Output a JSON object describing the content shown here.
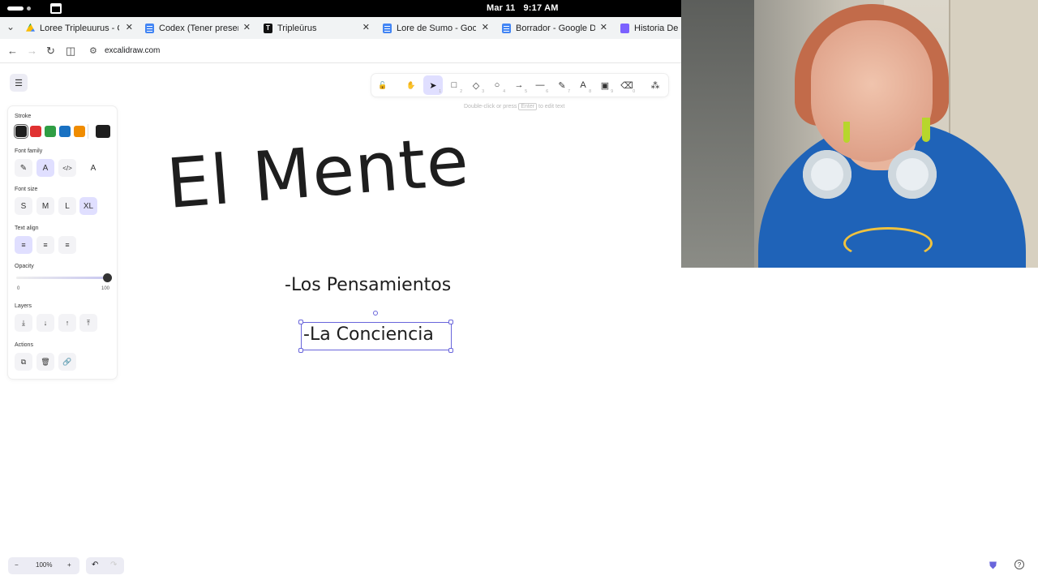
{
  "system": {
    "date": "Mar 11",
    "time": "9:17 AM"
  },
  "tabs": [
    {
      "label": "Loree Tripleuurus - Go",
      "icon": "drive-icon"
    },
    {
      "label": "Codex (Tener presente",
      "icon": "docs-icon"
    },
    {
      "label": "Tripleūrus",
      "icon": "t-icon",
      "glyph": "T"
    },
    {
      "label": "Lore de Sumo - Googl",
      "icon": "docs-icon"
    },
    {
      "label": "Borrador - Google Do",
      "icon": "docs-icon"
    },
    {
      "label": "Historia De Lo",
      "icon": "discord-icon"
    }
  ],
  "address": {
    "url": "excalidraw.com"
  },
  "toolbar": {
    "hint_before": "Double-click or press",
    "hint_key": "Enter",
    "hint_after": "to edit text",
    "tools": [
      {
        "name": "lock",
        "glyph": "🔓",
        "key": ""
      },
      {
        "name": "hand",
        "glyph": "✋",
        "key": ""
      },
      {
        "name": "selection",
        "glyph": "➤",
        "key": "1",
        "active": true
      },
      {
        "name": "rectangle",
        "glyph": "□",
        "key": "2"
      },
      {
        "name": "diamond",
        "glyph": "◇",
        "key": "3"
      },
      {
        "name": "ellipse",
        "glyph": "○",
        "key": "4"
      },
      {
        "name": "arrow",
        "glyph": "→",
        "key": "5"
      },
      {
        "name": "line",
        "glyph": "—",
        "key": "6"
      },
      {
        "name": "draw",
        "glyph": "✎",
        "key": "7"
      },
      {
        "name": "text",
        "glyph": "A",
        "key": "8"
      },
      {
        "name": "image",
        "glyph": "▣",
        "key": "9"
      },
      {
        "name": "eraser",
        "glyph": "⌫",
        "key": "0"
      },
      {
        "name": "extra-tools",
        "glyph": "⁂",
        "key": ""
      }
    ]
  },
  "panel": {
    "stroke_label": "Stroke",
    "stroke_colors": [
      "#1e1e1e",
      "#e03131",
      "#2f9e44",
      "#1971c2",
      "#f08c00"
    ],
    "stroke_current": "#1e1e1e",
    "font_family_label": "Font family",
    "font_size_label": "Font size",
    "font_sizes": [
      "S",
      "M",
      "L",
      "XL"
    ],
    "text_align_label": "Text align",
    "opacity_label": "Opacity",
    "opacity_min": "0",
    "opacity_max": "100",
    "opacity_value": 100,
    "layers_label": "Layers",
    "actions_label": "Actions"
  },
  "canvas": {
    "title": "El Mente",
    "line1": "-Los Pensamientos",
    "line2": "-La Conciencia"
  },
  "footer": {
    "zoom": "100%",
    "zoom_out": "−",
    "zoom_in": "+",
    "undo": "↶",
    "redo": "↷"
  },
  "colors": {
    "accent": "#6965db",
    "accent_light": "#e0dfff"
  }
}
